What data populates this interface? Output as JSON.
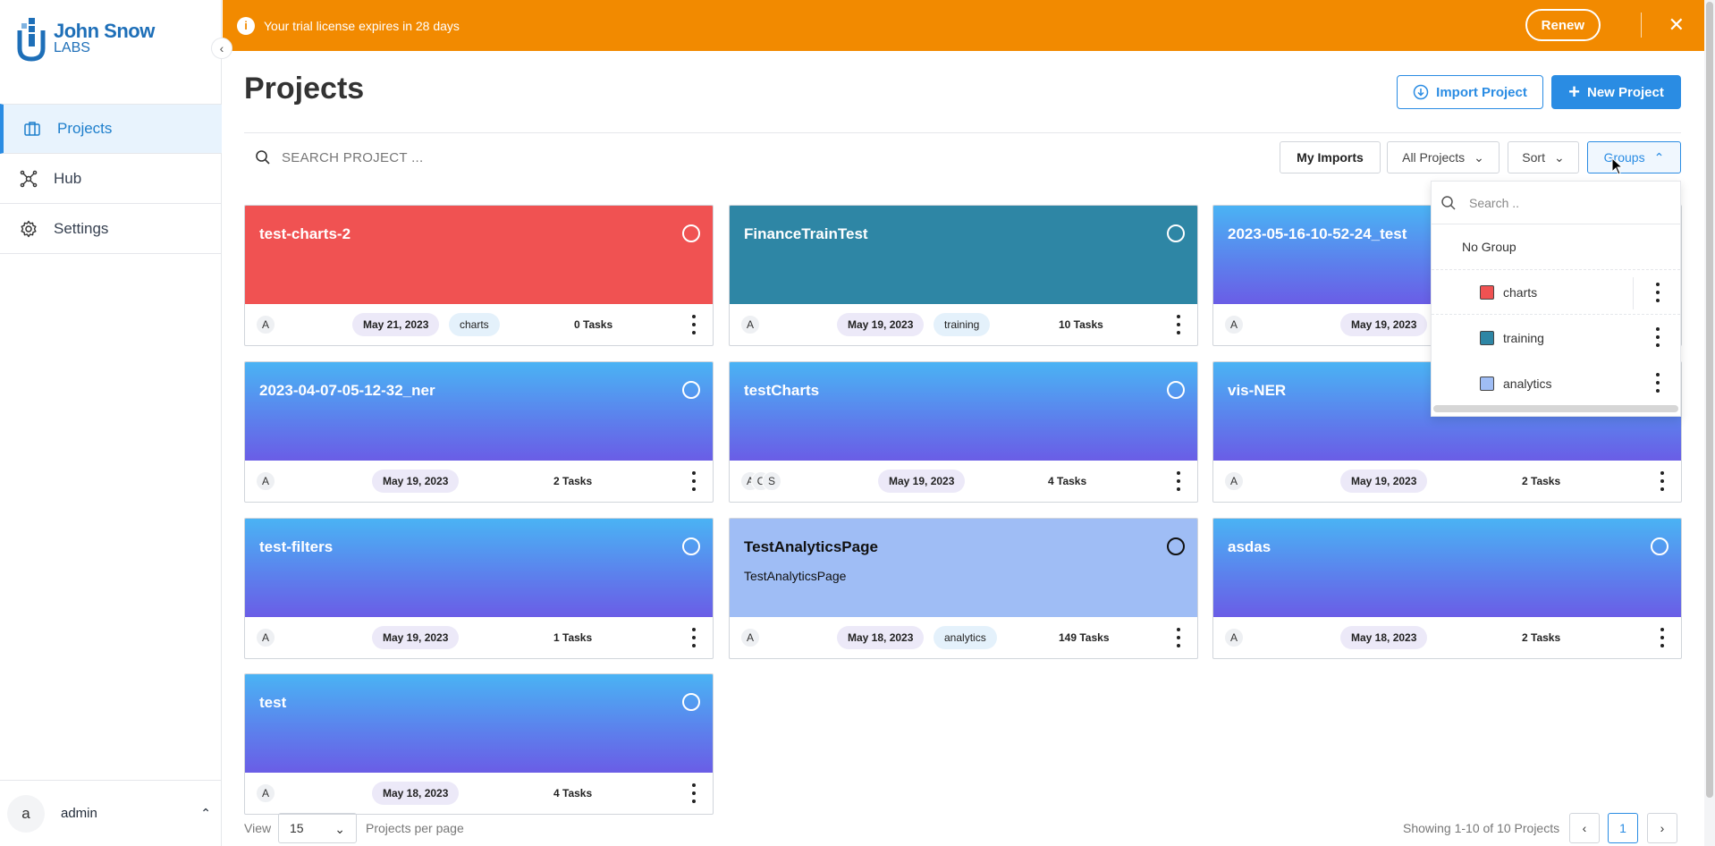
{
  "brand": {
    "line1": "John Snow",
    "line2": "LABS"
  },
  "banner": {
    "message": "Your trial license expires in 28 days",
    "renew_label": "Renew",
    "color": "#f28a00"
  },
  "sidebar": {
    "items": [
      {
        "label": "Projects",
        "icon": "projects-icon",
        "active": true
      },
      {
        "label": "Hub",
        "icon": "hub-icon",
        "active": false
      },
      {
        "label": "Settings",
        "icon": "gear-icon",
        "active": false
      }
    ],
    "user": {
      "avatar_letter": "a",
      "name": "admin"
    }
  },
  "header": {
    "title": "Projects",
    "import_label": "Import Project",
    "new_label": "New Project"
  },
  "toolbar": {
    "search_placeholder": "SEARCH PROJECT ...",
    "my_imports": "My Imports",
    "all_projects": "All Projects",
    "sort": "Sort",
    "groups": "Groups"
  },
  "groups_dropdown": {
    "search_placeholder": "Search ..",
    "no_group": "No Group",
    "groups": [
      {
        "name": "charts",
        "color": "#f05252"
      },
      {
        "name": "training",
        "color": "#2e86a5"
      },
      {
        "name": "analytics",
        "color": "#9fbdf5"
      }
    ]
  },
  "projects": [
    {
      "name": "test-charts-2",
      "desc": "",
      "avatars": [
        "A"
      ],
      "date": "May 21, 2023",
      "tag": "charts",
      "tasks": "0 Tasks",
      "color": "#f05252"
    },
    {
      "name": "FinanceTrainTest",
      "desc": "",
      "avatars": [
        "A"
      ],
      "date": "May 19, 2023",
      "tag": "training",
      "tasks": "10 Tasks",
      "color": "#2e86a5"
    },
    {
      "name": "2023-05-16-10-52-24_test",
      "desc": "",
      "avatars": [
        "A"
      ],
      "date": "May 19, 2023",
      "tag": "",
      "tasks": "",
      "color": "gradient"
    },
    {
      "name": "2023-04-07-05-12-32_ner",
      "desc": "",
      "avatars": [
        "A"
      ],
      "date": "May 19, 2023",
      "tag": "",
      "tasks": "2 Tasks",
      "color": "gradient"
    },
    {
      "name": "testCharts",
      "desc": "",
      "avatars": [
        "A",
        "C",
        "S"
      ],
      "date": "May 19, 2023",
      "tag": "",
      "tasks": "4 Tasks",
      "color": "gradient"
    },
    {
      "name": "vis-NER",
      "desc": "",
      "avatars": [
        "A"
      ],
      "date": "May 19, 2023",
      "tag": "",
      "tasks": "2 Tasks",
      "color": "gradient"
    },
    {
      "name": "test-filters",
      "desc": "",
      "avatars": [
        "A"
      ],
      "date": "May 19, 2023",
      "tag": "",
      "tasks": "1 Tasks",
      "color": "gradient"
    },
    {
      "name": "TestAnalyticsPage",
      "desc": "TestAnalyticsPage",
      "avatars": [
        "A"
      ],
      "date": "May 18, 2023",
      "tag": "analytics",
      "tasks": "149 Tasks",
      "color": "#9fbdf5"
    },
    {
      "name": "asdas",
      "desc": "",
      "avatars": [
        "A"
      ],
      "date": "May 18, 2023",
      "tag": "",
      "tasks": "2 Tasks",
      "color": "gradient"
    },
    {
      "name": "test",
      "desc": "",
      "avatars": [
        "A"
      ],
      "date": "May 18, 2023",
      "tag": "",
      "tasks": "4 Tasks",
      "color": "gradient"
    }
  ],
  "footer": {
    "view_label": "View",
    "per_page_value": "15",
    "per_page_label": "Projects per page",
    "showing": "Showing 1-10 of 10 Projects",
    "page": "1"
  }
}
